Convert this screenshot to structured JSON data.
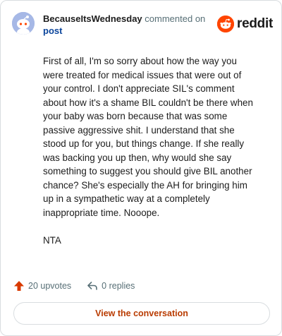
{
  "header": {
    "username": "BecauseItsWednesday",
    "action_text": "commented on",
    "post_link": "post",
    "brand_name": "reddit"
  },
  "comment": {
    "paragraphs": [
      "First of all, I'm so sorry about how the way you were treated for medical issues that were out of your control. I don't appreciate SIL's comment about how it's a shame BIL couldn't be there when your baby was born because that was some passive aggressive shit. I understand that she stood up for you, but things change. If she really was backing you up then, why would she say something to suggest you should give BIL another chance? She's especially the AH for bringing him up in a sympathetic way at a completely inappropriate time. Nooope.",
      "NTA"
    ]
  },
  "footer": {
    "upvotes": "20 upvotes",
    "replies": "0 replies",
    "cta_label": "View the conversation"
  },
  "colors": {
    "brand": "#ff4500",
    "upvote": "#d93a00",
    "link": "#0a449b",
    "cta_text": "#b93b00",
    "avatar_bg": "#a6b8e6"
  },
  "icons": [
    "avatar-snoo",
    "reddit-logo-icon",
    "upvote-arrow-icon",
    "reply-arrow-icon"
  ]
}
